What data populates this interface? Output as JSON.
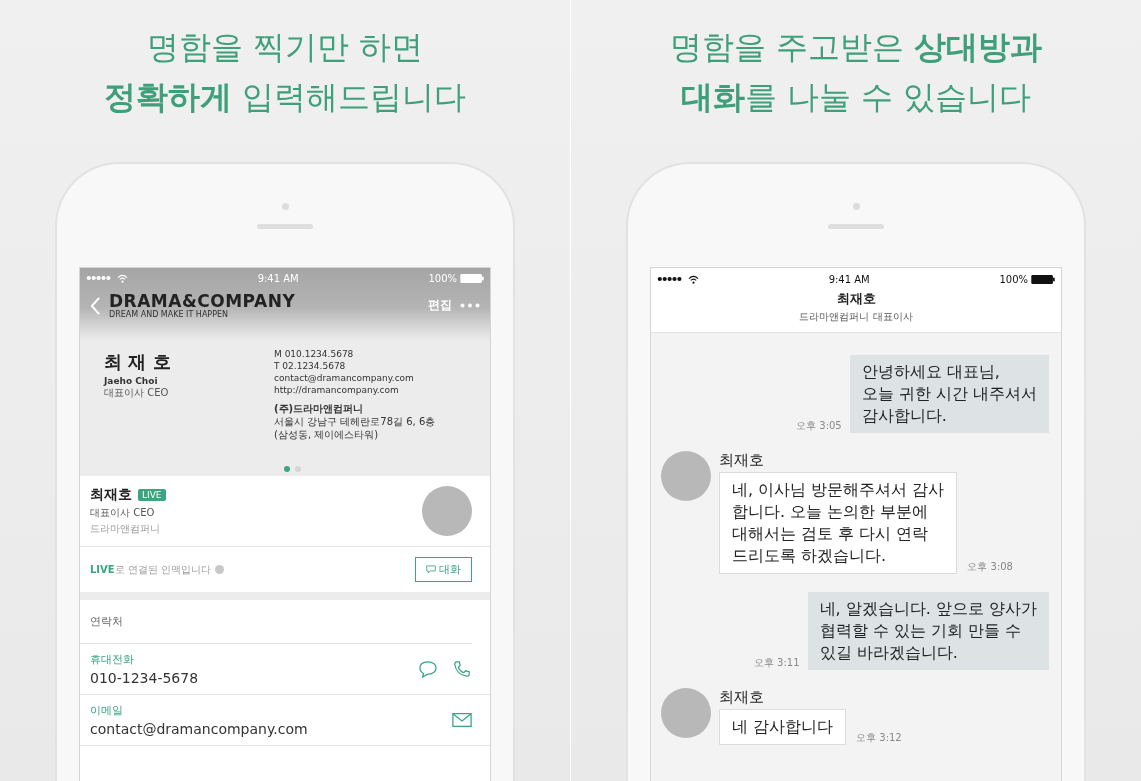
{
  "left_panel": {
    "headline": [
      "명함을 찍기만 하면",
      "**정확하게** 입력해드립니다"
    ],
    "status_bar": {
      "time": "9:41 AM",
      "battery": "100%"
    },
    "header": {
      "logo": "DRAMA&COMPANY",
      "logo_tagline": "DREAM AND MAKE IT HAPPEN",
      "edit": "편집"
    },
    "card": {
      "name": "최 재 호",
      "name_en": "Jaeho Choi",
      "title": "대표이사 CEO",
      "contacts": [
        "M 010.1234.5678",
        "T 02.1234.5678",
        "contact@dramancompany.com",
        "http://dramancompany.com"
      ],
      "address": [
        "(주)드라마앤컴퍼니",
        "서울시 강남구 테헤란로78길 6, 6층",
        "(삼성동, 제이에스타워)"
      ],
      "pages": [
        {
          "selected": true
        },
        {
          "selected": false
        }
      ]
    },
    "profile": {
      "name": "최재호",
      "badge": "LIVE",
      "title": "대표이사 CEO",
      "company": "드라마앤컴퍼니"
    },
    "live_note": "**LIVE**로 연결된 인맥입니다",
    "chat_button": "대화",
    "section_title": "연락처",
    "fields": [
      {
        "label": "휴대전화",
        "value": "010-1234-5678",
        "kind": "phone"
      },
      {
        "label": "이메일",
        "value": "contact@dramancompany.com",
        "kind": "email"
      }
    ]
  },
  "right_panel": {
    "headline": [
      "명함을 주고받은 **상대방과**",
      "**대화**를 나눌 수 있습니다"
    ],
    "status_bar": {
      "time": "9:41 AM",
      "battery": "100%"
    },
    "chat_header": {
      "name": "최재호",
      "subtitle": "드라마앤컴퍼니 대표이사"
    },
    "messages": [
      {
        "kind": "sent",
        "text": "안녕하세요 대표님,\n오늘  귀한 시간 내주셔서\n감사합니다.",
        "time": "오후 3:05"
      },
      {
        "kind": "received",
        "sender": "최재호",
        "text": "네, 이사님 방문해주셔서 감사\n합니다. 오늘 논의한 부분에\n대해서는 검토 후 다시 연락\n드리도록 하겠습니다.",
        "time": "오후 3:08"
      },
      {
        "kind": "sent",
        "text": "네, 알겠습니다. 앞으로 양사가\n협력할 수 있는 기회 만들 수\n있길 바라겠습니다.",
        "time": "오후 3:11"
      },
      {
        "kind": "received",
        "sender": "최재호",
        "text": "네 감사합니다",
        "time": "오후 3:12"
      }
    ]
  }
}
